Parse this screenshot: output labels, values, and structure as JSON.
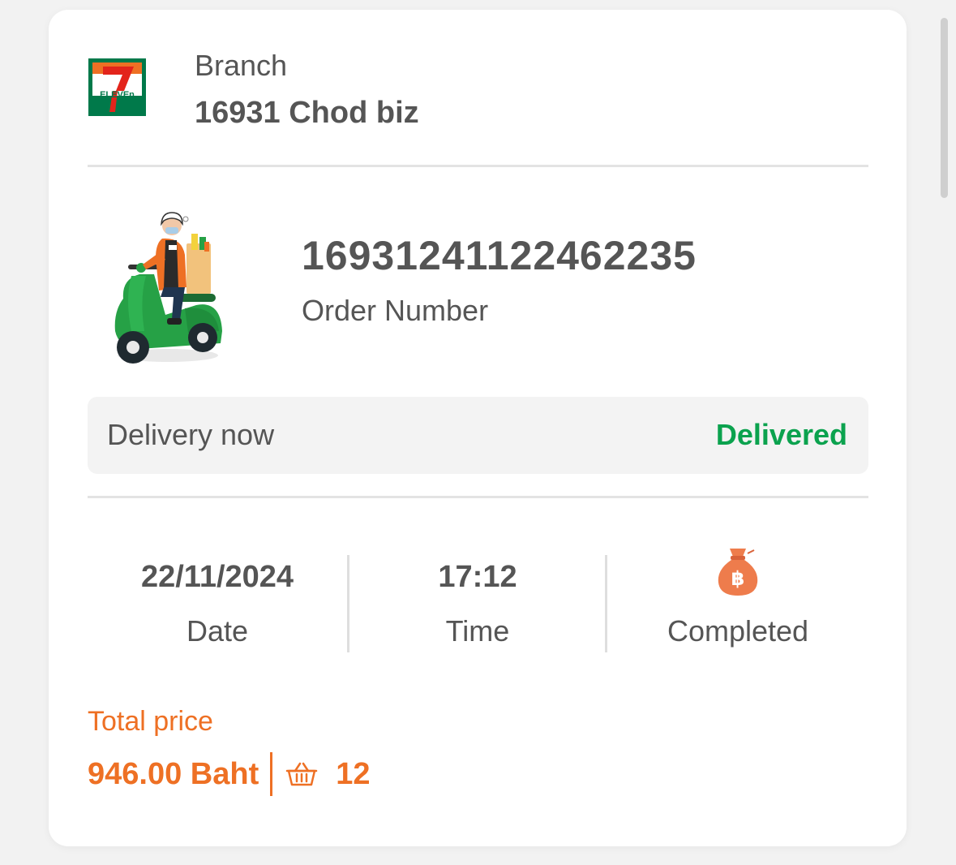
{
  "branch": {
    "label": "Branch",
    "name": "16931 Chod biz",
    "logo_icon": "seven-eleven-logo",
    "logo_text": "ELEVEn"
  },
  "order": {
    "number": "16931241122462235",
    "number_label": "Order Number",
    "illustration": "delivery-rider-scooter"
  },
  "delivery": {
    "type_label": "Delivery now",
    "status": "Delivered"
  },
  "info": {
    "date_value": "22/11/2024",
    "date_label": "Date",
    "time_value": "17:12",
    "time_label": "Time",
    "payment_icon": "money-bag-baht-icon",
    "payment_label": "Completed"
  },
  "total": {
    "label": "Total price",
    "amount": "946.00 Baht",
    "basket_icon": "basket-icon",
    "item_count": "12"
  },
  "colors": {
    "accent_orange": "#ee7024",
    "status_green": "#0ba24e",
    "text_gray": "#555555",
    "brand_green": "#00794a",
    "brand_red": "#e3241b"
  }
}
